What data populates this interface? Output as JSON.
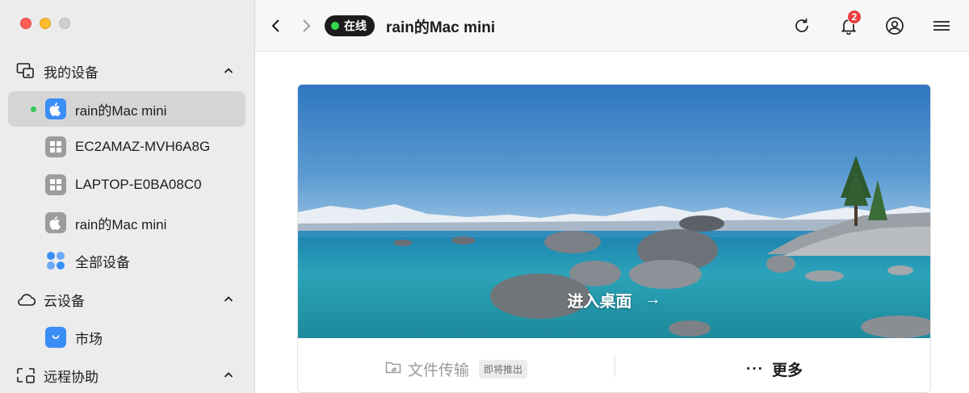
{
  "sidebar": {
    "sections": {
      "my_devices": "我的设备",
      "cloud_devices": "云设备",
      "remote_assist": "远程协助"
    },
    "items": [
      {
        "label": "rain的Mac mini",
        "icon": "apple-icon",
        "icon_color": "#3a8ef6",
        "online": true,
        "active": true
      },
      {
        "label": "EC2AMAZ-MVH6A8G",
        "icon": "windows-icon",
        "icon_color": "#9c9c9c"
      },
      {
        "label": "LAPTOP-E0BA08C0",
        "icon": "windows-icon",
        "icon_color": "#9c9c9c"
      },
      {
        "label": "rain的Mac mini",
        "icon": "apple-icon",
        "icon_color": "#9c9c9c"
      },
      {
        "label": "全部设备",
        "icon": "grid-dots-icon",
        "icon_color": "#3a8ef6"
      }
    ],
    "cloud_items": [
      {
        "label": "市场",
        "icon": "shopping-bag-icon",
        "icon_color": "#3a8ef6"
      }
    ]
  },
  "toolbar": {
    "status": "在线",
    "status_color": "#32d74b",
    "device_name": "rain的Mac mini",
    "notification_count": "2"
  },
  "card": {
    "enter_desktop": "进入桌面",
    "enter_arrow": "→",
    "file_transfer": "文件传输",
    "coming_soon": "即将推出",
    "more_dots": "···",
    "more": "更多"
  }
}
